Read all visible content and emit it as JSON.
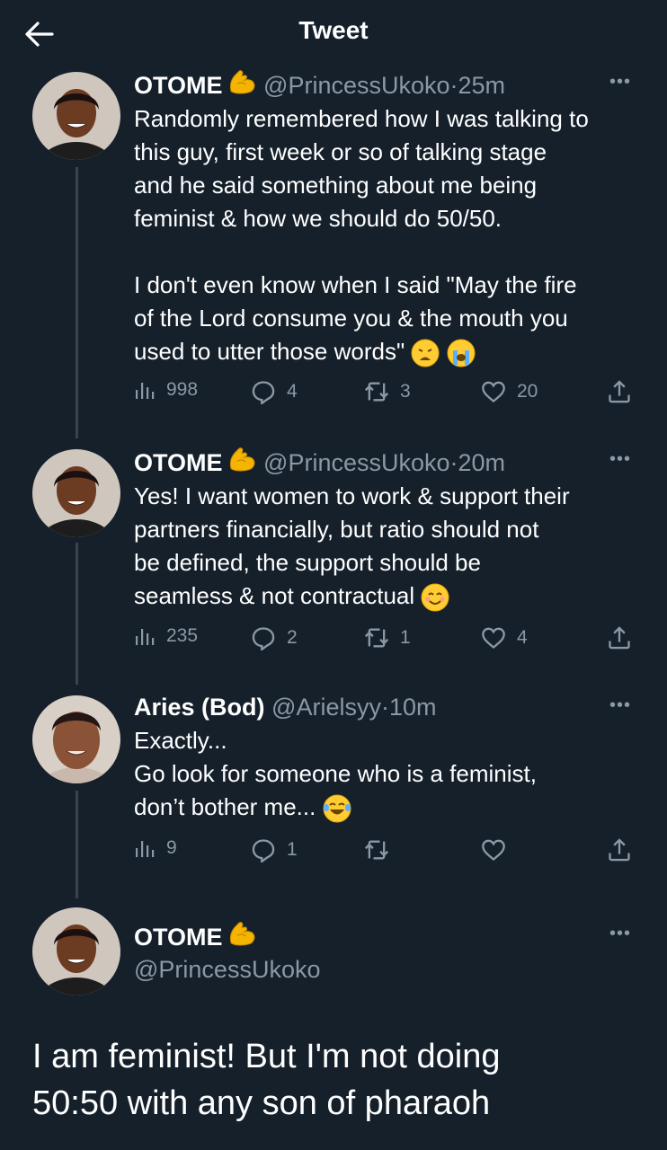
{
  "header": {
    "title": "Tweet"
  },
  "colors": {
    "background": "#15202b",
    "secondary_text": "#8b98a5",
    "thread_line": "#38444d"
  },
  "tweets": [
    {
      "name": "OTOME",
      "handle": "@PrincessUkoko",
      "dot": "·",
      "time": "25m",
      "text": "Randomly remembered how I was talking to\nthis guy, first week or so of talking stage\nand he said something about me being\nfeminist & how we should do 50/50.\n\nI don't even know when I said \"May the fire\nof the Lord consume you & the mouth you\nused to utter those words\"",
      "emojis": [
        "weary-face",
        "loudly-crying-face"
      ],
      "views": "998",
      "replies": "4",
      "retweets": "3",
      "likes": "20"
    },
    {
      "name": "OTOME",
      "handle": "@PrincessUkoko",
      "dot": "·",
      "time": "20m",
      "text": "Yes! I want women to work & support their\npartners financially, but ratio should not\nbe defined, the support should be\nseamless & not contractual",
      "emojis": [
        "smiling-face"
      ],
      "views": "235",
      "replies": "2",
      "retweets": "1",
      "likes": "4"
    },
    {
      "name": "Aries (Bod)",
      "handle": "@Arielsyy",
      "dot": "·",
      "time": "10m",
      "text": "Exactly...\nGo look for someone who is a feminist,\ndon’t bother me...",
      "emojis": [
        "laughing-tears-face"
      ],
      "views": "9",
      "replies": "1",
      "retweets": "",
      "likes": ""
    }
  ],
  "main_tweet": {
    "name": "OTOME",
    "handle": "@PrincessUkoko",
    "text": "I am feminist! But I'm not doing\n50:50 with any son of pharaoh"
  }
}
